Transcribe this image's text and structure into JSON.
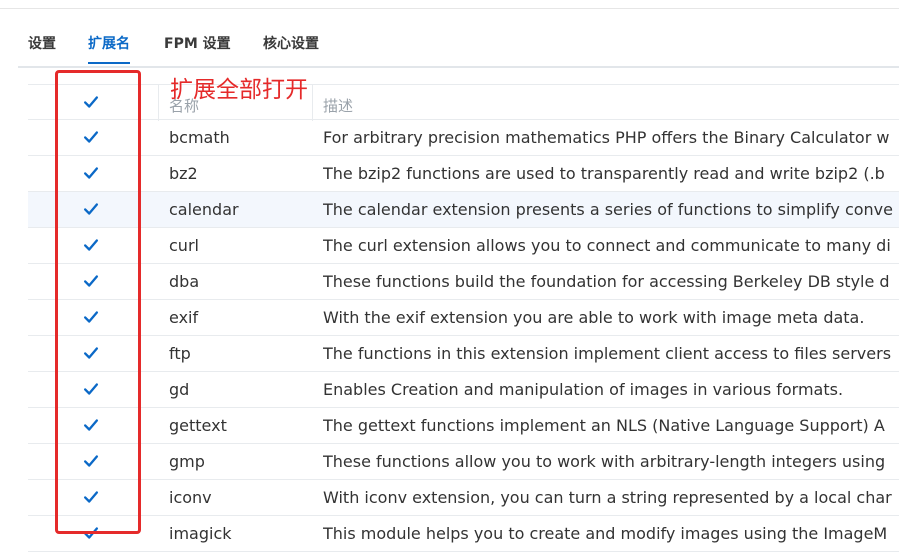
{
  "tabs": [
    {
      "label": "设置",
      "active": false
    },
    {
      "label": "扩展名",
      "active": true
    },
    {
      "label": "FPM 设置",
      "active": false
    },
    {
      "label": "核心设置",
      "active": false
    }
  ],
  "annotation": "扩展全部打开",
  "table": {
    "columns": {
      "name": "名称",
      "desc": "描述"
    },
    "header_checked": true,
    "rows": [
      {
        "name": "bcmath",
        "desc": "For arbitrary precision mathematics PHP offers the Binary Calculator w",
        "checked": true
      },
      {
        "name": "bz2",
        "desc": "The bzip2 functions are used to transparently read and write bzip2 (.b",
        "checked": true
      },
      {
        "name": "calendar",
        "desc": "The calendar extension presents a series of functions to simplify conve",
        "checked": true,
        "highlight": true
      },
      {
        "name": "curl",
        "desc": "The curl extension allows you to connect and communicate to many di",
        "checked": true
      },
      {
        "name": "dba",
        "desc": "These functions build the foundation for accessing Berkeley DB style d",
        "checked": true
      },
      {
        "name": "exif",
        "desc": "With the exif extension you are able to work with image meta data.",
        "checked": true
      },
      {
        "name": "ftp",
        "desc": "The functions in this extension implement client access to files servers",
        "checked": true
      },
      {
        "name": "gd",
        "desc": "Enables Creation and manipulation of images in various formats.",
        "checked": true
      },
      {
        "name": "gettext",
        "desc": "The gettext functions implement an NLS (Native Language Support) A",
        "checked": true
      },
      {
        "name": "gmp",
        "desc": "These functions allow you to work with arbitrary-length integers using",
        "checked": true
      },
      {
        "name": "iconv",
        "desc": "With iconv extension, you can turn a string represented by a local char",
        "checked": true
      },
      {
        "name": "imagick",
        "desc": "This module helps you to create and modify images using the ImageM",
        "checked": true
      }
    ]
  },
  "colors": {
    "accent": "#0b69c7",
    "annotation": "#e52a2a",
    "highlight_row": "#f3f7fd"
  },
  "icons": {
    "checkbox_checked": "checkmark-icon"
  }
}
